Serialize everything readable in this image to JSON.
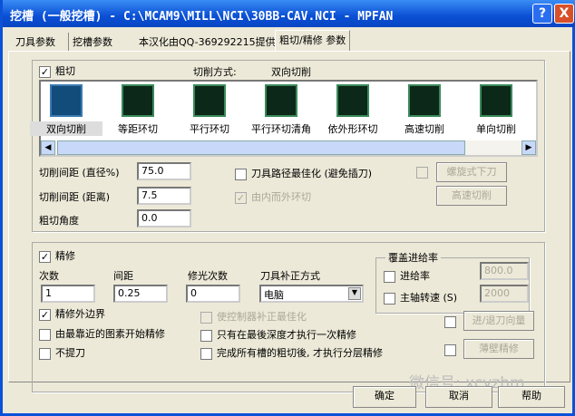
{
  "window": {
    "title": "挖槽 (一般挖槽) - C:\\MCAM9\\MILL\\NCI\\30BB-CAV.NCI - MPFAN",
    "help": "?",
    "close": "X"
  },
  "tabs": [
    "刀具参数",
    "挖槽参数",
    "本汉化由QQ-369292215提供",
    "粗切/精修 参数"
  ],
  "rough": {
    "label": "粗切",
    "checked": true,
    "method_label": "切削方式:",
    "method_value": "双向切削",
    "methods": [
      "双向切削",
      "等距环切",
      "平行环切",
      "平行环切清角",
      "依外形环切",
      "高速切削",
      "单向切削"
    ],
    "stepover_pct_label": "切削间距 (直径%)",
    "stepover_pct": "75.0",
    "stepover_dist_label": "切削间距 (距离)",
    "stepover_dist": "7.5",
    "angle_label": "粗切角度",
    "angle": "0.0",
    "optimize_label": "刀具路径最佳化 (避免插刀)",
    "inside_out_label": "由内而外环切",
    "helix_button": "螺旋式下刀",
    "hs_button": "高速切削"
  },
  "finish": {
    "label": "精修",
    "checked": true,
    "passes_label": "次数",
    "passes": "1",
    "spacing_label": "间距",
    "spacing": "0.25",
    "spring_label": "修光次数",
    "spring": "0",
    "comp_label": "刀具补正方式",
    "comp": "电脑",
    "outer_label": "精修外边界",
    "nearest_label": "由最靠近的图素开始精修",
    "noretract_label": "不提刀",
    "ctrl_opt_label": "使控制器补正最佳化",
    "final_depth_label": "只有在最後深度才执行一次精修",
    "after_all_label": "完成所有槽的粗切後, 才执行分层精修",
    "override_title": "覆盖进给率",
    "feed_label": "进给率",
    "feed": "800.0",
    "spindle_label": "主轴转速 (S)",
    "spindle": "2000",
    "leadio_button": "进/退刀向量",
    "thinwall_button": "薄壁精修"
  },
  "buttons": {
    "ok": "确定",
    "cancel": "取消",
    "help": "帮助"
  },
  "watermark": "微信号: xcyzhm"
}
